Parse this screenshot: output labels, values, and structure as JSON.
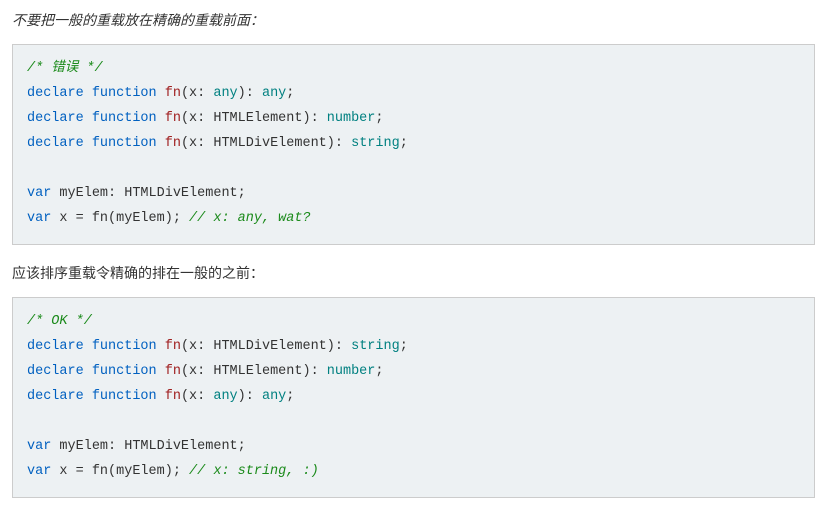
{
  "intro": "不要把一般的重载放在精确的重载前面：",
  "block1": {
    "c1": "/* 错误 */",
    "l1": {
      "kw1": "declare",
      "kw2": "function",
      "fn": "fn",
      "p1": "(x: ",
      "ty": "any",
      "p2": "): ",
      "ret": "any",
      "end": ";"
    },
    "l2": {
      "kw1": "declare",
      "kw2": "function",
      "fn": "fn",
      "p1": "(x: HTMLElement): ",
      "ret": "number",
      "end": ";"
    },
    "l3": {
      "kw1": "declare",
      "kw2": "function",
      "fn": "fn",
      "p1": "(x: HTMLDivElement): ",
      "ret": "string",
      "end": ";"
    },
    "l4": {
      "kw": "var",
      "rest": " myElem: HTMLDivElement;"
    },
    "l5": {
      "kw": "var",
      "mid": " x = fn(myElem); ",
      "cm": "// x: any, wat?"
    }
  },
  "mid_text": "应该排序重载令精确的排在一般的之前：",
  "block2": {
    "c1": "/* OK */",
    "l1": {
      "kw1": "declare",
      "kw2": "function",
      "fn": "fn",
      "p1": "(x: HTMLDivElement): ",
      "ret": "string",
      "end": ";"
    },
    "l2": {
      "kw1": "declare",
      "kw2": "function",
      "fn": "fn",
      "p1": "(x: HTMLElement): ",
      "ret": "number",
      "end": ";"
    },
    "l3": {
      "kw1": "declare",
      "kw2": "function",
      "fn": "fn",
      "p1": "(x: ",
      "ty": "any",
      "p2": "): ",
      "ret": "any",
      "end": ";"
    },
    "l4": {
      "kw": "var",
      "rest": " myElem: HTMLDivElement;"
    },
    "l5": {
      "kw": "var",
      "mid": " x = fn(myElem); ",
      "cm": "// x: string, :)"
    }
  }
}
